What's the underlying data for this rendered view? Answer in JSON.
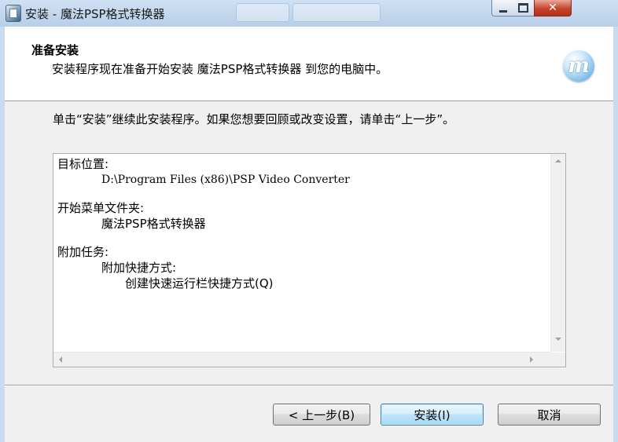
{
  "window": {
    "title": "安装 - 魔法PSP格式转换器",
    "close_glyph": "✕"
  },
  "header": {
    "title": "准备安装",
    "subtitle": "安装程序现在准备开始安装 魔法PSP格式转换器 到您的电脑中。",
    "logo_glyph": "m"
  },
  "instruction": "单击“安装”继续此安装程序。如果您想要回顾或改变设置，请单击“上一步”。",
  "summary": {
    "destination_label": "目标位置:",
    "destination_value": "D:\\Program Files (x86)\\PSP Video Converter",
    "start_menu_label": "开始菜单文件夹:",
    "start_menu_value": "魔法PSP格式转换器",
    "tasks_label": "附加任务:",
    "tasks_group": "附加快捷方式:",
    "tasks_item": "创建快速运行栏快捷方式(Q)"
  },
  "buttons": {
    "back": "< 上一步(B)",
    "install": "安装(I)",
    "cancel": "取消"
  }
}
